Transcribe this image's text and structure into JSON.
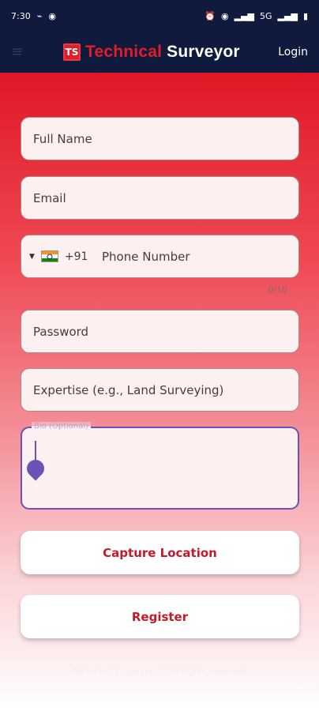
{
  "status": {
    "time": "7:30",
    "left_icons": [
      "wifi-calling-icon",
      "hotspot-icon"
    ],
    "right_icons": [
      "alarm-icon",
      "eye-icon",
      "volte-icon",
      "signal-icon",
      "5g-label",
      "signal-icon",
      "battery-icon"
    ],
    "network_label": "5G"
  },
  "appbar": {
    "logo_text": "TS",
    "brand_part1": "Technical",
    "brand_part2": "Surveyor",
    "login_label": "Login",
    "menu_icon": "menu-icon"
  },
  "form": {
    "full_name_placeholder": "Full Name",
    "email_placeholder": "Email",
    "country_code": "+91",
    "phone_placeholder": "Phone Number",
    "phone_counter": "0/10",
    "password_placeholder": "Password",
    "expertise_placeholder": "Expertise (e.g., Land Surveying)",
    "bio_label": "Bio (Optional)"
  },
  "buttons": {
    "capture_location": "Capture Location",
    "register": "Register"
  },
  "footer": {
    "text": "Technical Surveyor © All rights reserved"
  },
  "colors": {
    "primary_red": "#e11d2a",
    "navy": "#0f1a3c",
    "focus_purple": "#6a52b6"
  }
}
